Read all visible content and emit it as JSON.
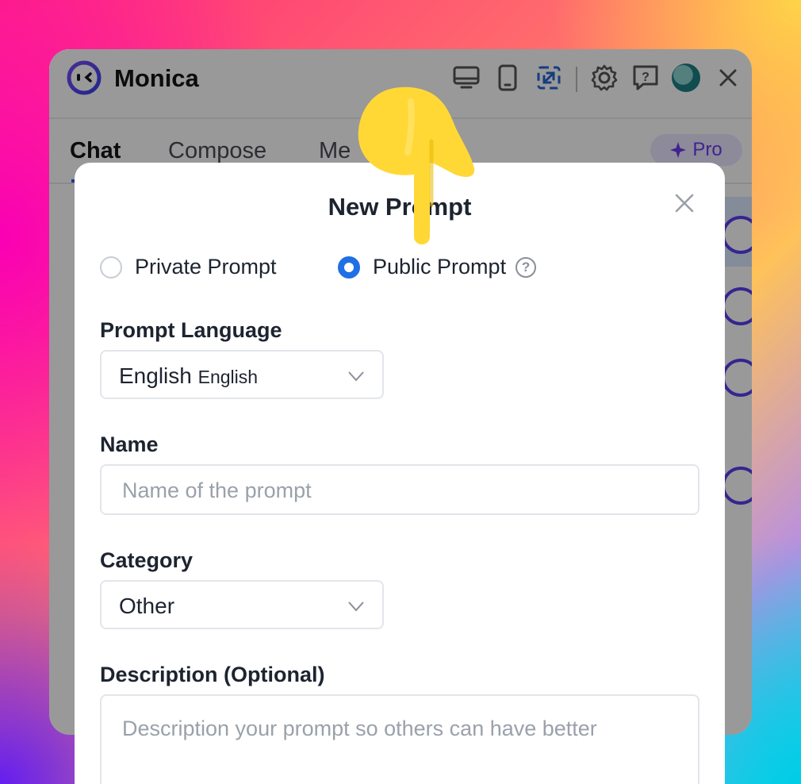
{
  "app": {
    "title": "Monica"
  },
  "toolbar": {
    "icons": [
      "desktop-icon",
      "phone-icon",
      "expand-icon",
      "settings-icon",
      "feedback-icon",
      "avatar",
      "close-icon"
    ]
  },
  "tabs": [
    {
      "label": "Chat",
      "active": true
    },
    {
      "label": "Compose",
      "active": false
    },
    {
      "label": "Me",
      "active": false
    }
  ],
  "pro_badge": {
    "label": "Pro"
  },
  "modal": {
    "title": "New Prompt",
    "radios": [
      {
        "label": "Private Prompt",
        "checked": false
      },
      {
        "label": "Public Prompt",
        "checked": true
      }
    ],
    "language": {
      "label": "Prompt Language",
      "value": "English",
      "value_native": "English"
    },
    "name": {
      "label": "Name",
      "placeholder": "Name of the prompt"
    },
    "category": {
      "label": "Category",
      "value": "Other"
    },
    "description": {
      "label": "Description (Optional)",
      "placeholder": "Description your prompt so others can have better"
    }
  },
  "colors": {
    "accent": "#1f6fe5",
    "brand": "#5b3df0",
    "pro": "#6a3df0",
    "pointer": "#ffd836"
  }
}
